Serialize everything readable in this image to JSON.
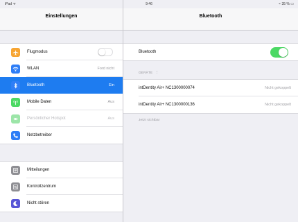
{
  "status_bar": {
    "carrier": "iPad ᯤ",
    "time": "9:46",
    "battery": "⌁ 35 % ▭"
  },
  "sidebar": {
    "title": "Einstellungen",
    "groups": [
      {
        "items": [
          {
            "label": "Flugmodus",
            "value": "",
            "icon": "airplane-icon",
            "icon_color": "#f7a532",
            "control": "toggle",
            "toggle_on": false
          },
          {
            "label": "WLAN",
            "value": "Ford nicht",
            "icon": "wifi-icon",
            "icon_color": "#2f7ef6"
          },
          {
            "label": "Bluetooth",
            "value": "Ein",
            "icon": "bluetooth-icon",
            "icon_color": "#2f7ef6",
            "selected": true
          },
          {
            "label": "Mobile Daten",
            "value": "Aus",
            "icon": "antenna-icon",
            "icon_color": "#4cd964"
          },
          {
            "label": "Persönlicher Hotspot",
            "value": "Aus",
            "icon": "hotspot-icon",
            "icon_color": "#9ce5a8",
            "muted": true
          },
          {
            "label": "Netzbetreiber",
            "value": "",
            "icon": "phone-icon",
            "icon_color": "#2f7ef6"
          }
        ]
      },
      {
        "items": [
          {
            "label": "Mitteilungen",
            "value": "",
            "icon": "notifications-icon",
            "icon_color": "#8e8e93"
          },
          {
            "label": "Kontrollzentrum",
            "value": "",
            "icon": "control-center-icon",
            "icon_color": "#8e8e93"
          },
          {
            "label": "Nicht stören",
            "value": "",
            "icon": "moon-icon",
            "icon_color": "#5856d6"
          }
        ]
      }
    ]
  },
  "detail": {
    "title": "Bluetooth",
    "bluetooth_label": "Bluetooth",
    "bluetooth_on": true,
    "devices_header": "GERÄTE",
    "devices": [
      {
        "name": "intDentity Air+ NC1300000074",
        "status": "Nicht gekoppelt"
      },
      {
        "name": "intDentity Air+ NC1300000136",
        "status": "Nicht gekoppelt"
      }
    ],
    "footer_note": "Jetzt sichtbar"
  },
  "colors": {
    "selected": "#1e7cf0",
    "toggle_on": "#4cd964",
    "background": "#efeff4"
  }
}
